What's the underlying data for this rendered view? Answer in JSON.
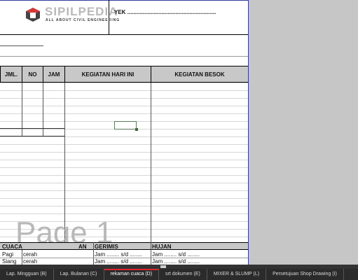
{
  "sheet": {
    "brand": "SIPILPEDIA",
    "tagline": "ALL ABOUT CIVIL ENGINEERING",
    "proyek_label": "YEK .........................................................",
    "cut_label": "...................",
    "watermark": "Page 1",
    "columns": [
      "JML.",
      "NO",
      "JAM",
      "KEGIATAN HARI INI",
      "KEGIATAN BESOK"
    ],
    "weather": {
      "cuaca": "CUACA",
      "cerah_head": "AN",
      "gerimis": "GERIMIS",
      "hujan": "HUJAN",
      "rows": [
        {
          "time": "Pagi",
          "cond": "cerah",
          "g": "Jam ........ s/d ........",
          "h": "Jam ........ s/d ........"
        },
        {
          "time": "Siang",
          "cond": "cerah",
          "g": "Jam ........ s/d ........",
          "h": "Jam ........ s/d ........"
        }
      ]
    },
    "colors": {
      "header_fill": "#c8c8c8",
      "tab_active": "#e0242c"
    }
  },
  "tabs": [
    {
      "label": "Lap. Mingguan (B)"
    },
    {
      "label": "Lap. Bulanan (C)"
    },
    {
      "label": "rekaman cuaca (D)",
      "active": true
    },
    {
      "label": "srt dokumen (E)"
    },
    {
      "label": "MIXER & SLUMP (L)"
    },
    {
      "label": "Persetujuan Shop Drawing (I)"
    }
  ]
}
